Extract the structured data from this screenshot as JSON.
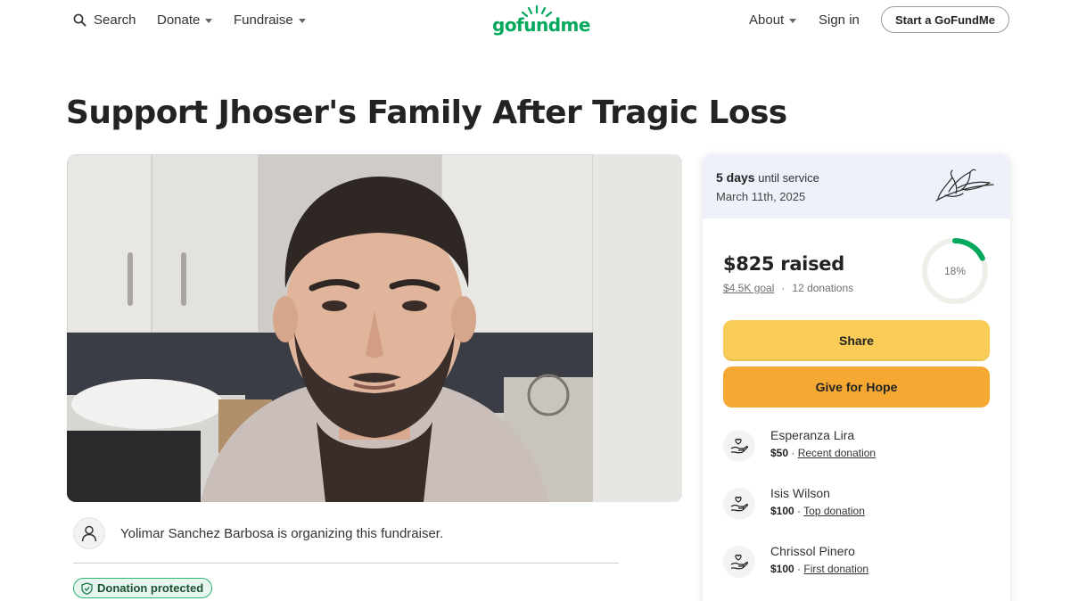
{
  "header": {
    "search_label": "Search",
    "donate_label": "Donate",
    "fundraise_label": "Fundraise",
    "logo_text": "gofundme",
    "about_label": "About",
    "signin_label": "Sign in",
    "start_label": "Start a GoFundMe"
  },
  "campaign": {
    "title": "Support Jhoser's Family After Tragic Loss",
    "organizer_text": "Yolimar Sanchez Barbosa is organizing this fundraiser.",
    "protected_label": "Donation protected"
  },
  "service": {
    "days": "5 days",
    "until_text": "until service",
    "date": "March 11th, 2025"
  },
  "progress": {
    "raised": "$825 raised",
    "goal": "$4.5K goal",
    "separator": "·",
    "donations": "12 donations",
    "percent_label": "18%",
    "percent_value": 0.18
  },
  "actions": {
    "share_label": "Share",
    "give_label": "Give for Hope"
  },
  "donors": [
    {
      "name": "Esperanza Lira",
      "amount": "$50",
      "tag": "Recent donation"
    },
    {
      "name": "Isis Wilson",
      "amount": "$100",
      "tag": "Top donation"
    },
    {
      "name": "Chrissol Pinero",
      "amount": "$100",
      "tag": "First donation"
    }
  ],
  "colors": {
    "brand_green": "#02a95c",
    "share_yellow": "#f8cc56",
    "give_orange": "#f6a932",
    "service_band": "#eef1fa"
  },
  "icons": {
    "search": "search-icon",
    "logo_sun": "logo-sun-icon",
    "lily": "lily-flower-icon",
    "user": "user-icon",
    "shield": "shield-icon",
    "donor": "heart-hand-icon"
  }
}
